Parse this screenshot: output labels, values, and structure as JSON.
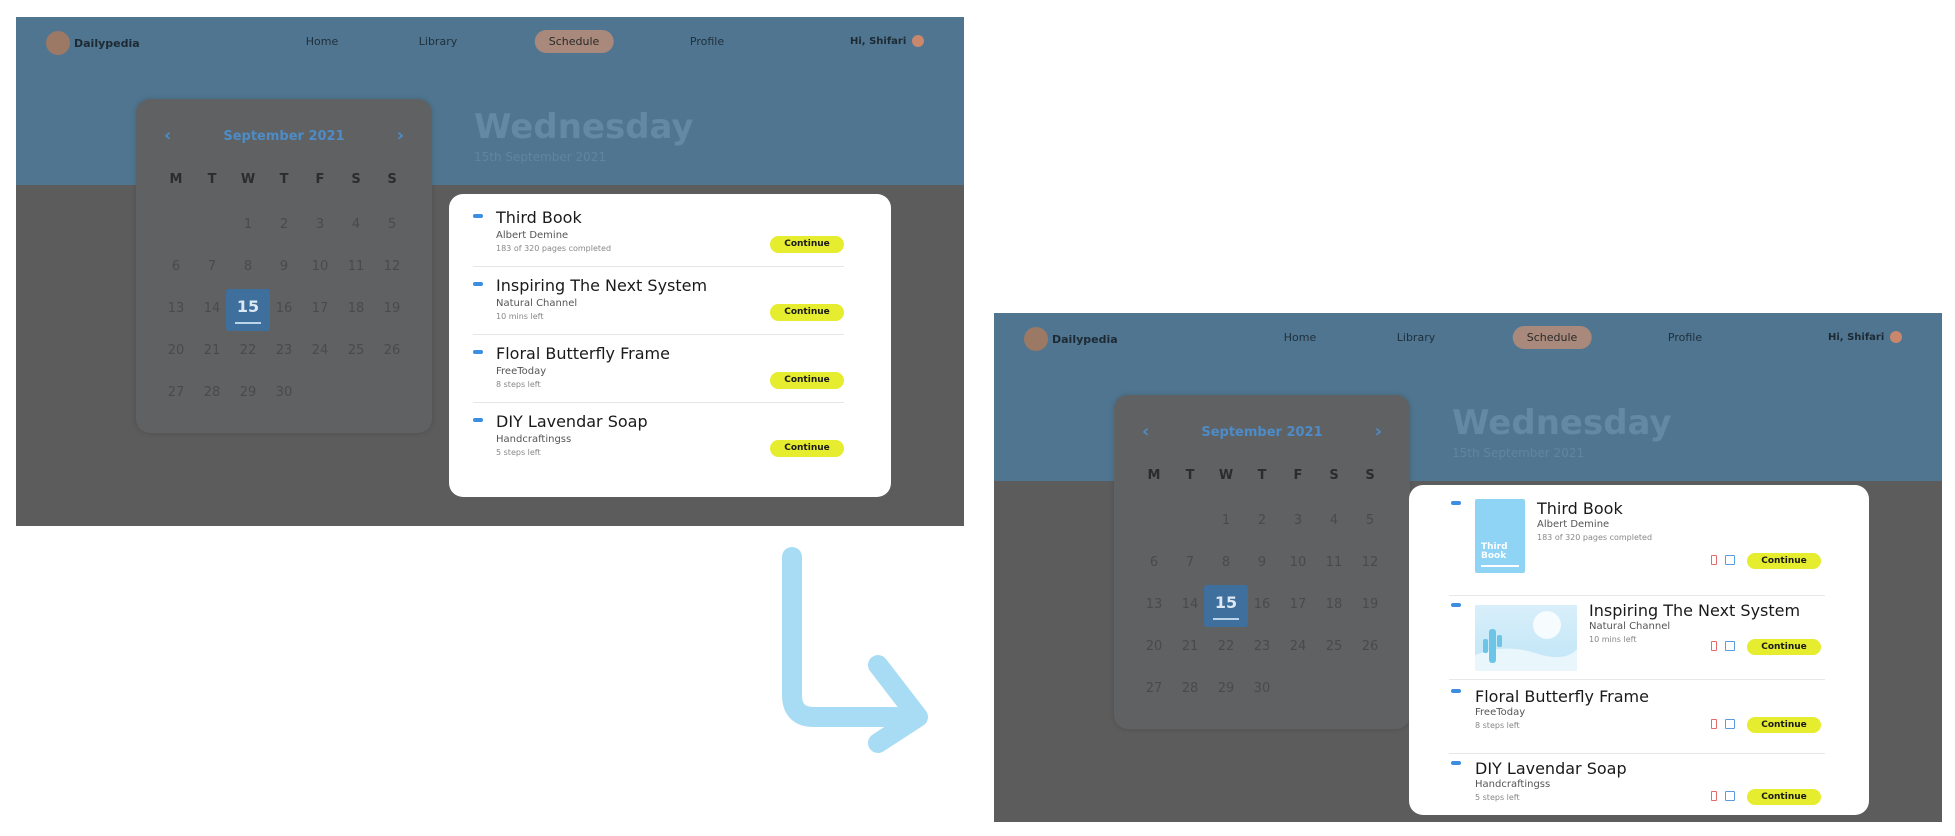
{
  "app": {
    "logo_text": "Dailypedia",
    "nav": [
      "Home",
      "Library",
      "Schedule",
      "Profile"
    ],
    "active_nav": "Schedule",
    "greeting": "Hi, Shifari"
  },
  "calendar": {
    "month_label": "September 2021",
    "prev_icon": "chevron-left-icon",
    "next_icon": "chevron-right-icon",
    "weekdays": [
      "M",
      "T",
      "W",
      "T",
      "F",
      "S",
      "S"
    ],
    "days": [
      "1",
      "2",
      "3",
      "4",
      "5",
      "6",
      "7",
      "8",
      "9",
      "10",
      "11",
      "12",
      "13",
      "14",
      "15",
      "16",
      "17",
      "18",
      "19",
      "20",
      "21",
      "22",
      "23",
      "24",
      "25",
      "26",
      "27",
      "28",
      "29",
      "30"
    ],
    "selected_day": "15"
  },
  "header": {
    "day_name": "Wednesday",
    "date_text": "15th September 2021"
  },
  "tasks": [
    {
      "title": "Third Book",
      "subtitle": "Albert Demine",
      "meta": "183 of 320 pages completed",
      "action": "Continue",
      "cover_text": "Third Book"
    },
    {
      "title": "Inspiring The Next System",
      "subtitle": "Natural Channel",
      "meta": "10 mins left",
      "action": "Continue"
    },
    {
      "title": "Floral Butterfly Frame",
      "subtitle": "FreeToday",
      "meta": "8 steps left",
      "action": "Continue"
    },
    {
      "title": "DIY Lavendar Soap",
      "subtitle": "Handcraftingss",
      "meta": "5 steps left",
      "action": "Continue"
    }
  ],
  "colors": {
    "accent_blue": "#3b8ee0",
    "button_yellow": "#e6ec2e",
    "arrow_blue": "#a8dcf5",
    "overlay_gray": "#5c5c5c",
    "header_band": "#4f7590"
  },
  "icons": {
    "delete": "trash-icon",
    "schedule": "calendar-icon",
    "transition": "turn-right-arrow-icon"
  }
}
